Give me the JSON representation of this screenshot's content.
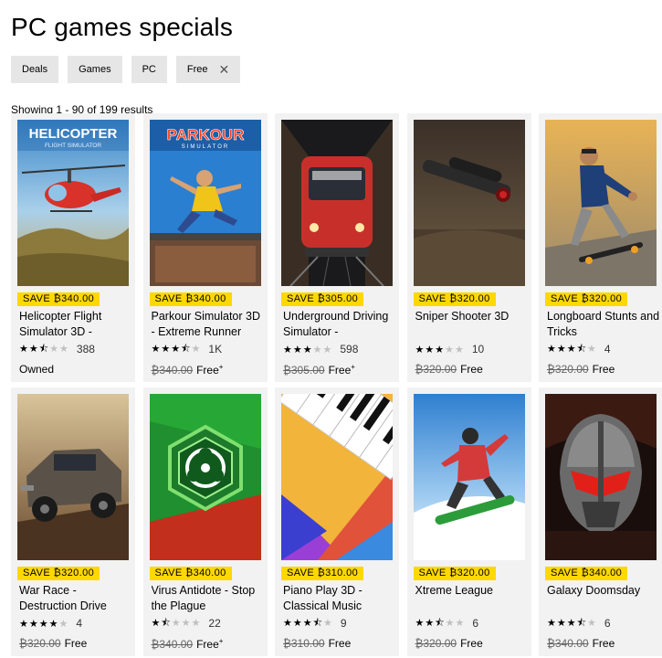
{
  "page": {
    "title": "PC games specials"
  },
  "filters": [
    {
      "label": "Deals",
      "removable": false
    },
    {
      "label": "Games",
      "removable": false
    },
    {
      "label": "PC",
      "removable": false
    },
    {
      "label": "Free",
      "removable": true,
      "remove_icon": "close-icon"
    }
  ],
  "results": {
    "text": "Showing 1 - 90 of 199 results"
  },
  "colors": {
    "badge": "#ffd800",
    "chip_bg": "#e6e6e6",
    "tile_bg": "#f2f2f2"
  },
  "products": [
    {
      "title": "Helicopter Flight Simulator 3D -",
      "badge": "SAVE ₿340.00",
      "stars": 2.5,
      "rating_count": "388",
      "price_original": "",
      "price_now": "Owned",
      "plus": "",
      "art": "helicopter"
    },
    {
      "title": "Parkour Simulator 3D - Extreme Runner",
      "badge": "SAVE ₿340.00",
      "stars": 3.5,
      "rating_count": "1K",
      "price_original": "₿340.00",
      "price_now": "Free",
      "plus": "+",
      "art": "parkour"
    },
    {
      "title": "Underground Driving Simulator -",
      "badge": "SAVE ₿305.00",
      "stars": 3,
      "rating_count": "598",
      "price_original": "₿305.00",
      "price_now": "Free",
      "plus": "+",
      "art": "train"
    },
    {
      "title": "Sniper Shooter 3D",
      "badge": "SAVE ₿320.00",
      "stars": 3,
      "rating_count": "10",
      "price_original": "₿320.00",
      "price_now": "Free",
      "plus": "",
      "art": "sniper"
    },
    {
      "title": "Longboard Stunts and Tricks",
      "badge": "SAVE ₿320.00",
      "stars": 3.5,
      "rating_count": "4",
      "price_original": "₿320.00",
      "price_now": "Free",
      "plus": "",
      "art": "longboard"
    },
    {
      "title": "War Race - Destruction Drive",
      "badge": "SAVE ₿320.00",
      "stars": 4,
      "rating_count": "4",
      "price_original": "₿320.00",
      "price_now": "Free",
      "plus": "",
      "art": "warrace"
    },
    {
      "title": "Virus Antidote - Stop the Plague",
      "badge": "SAVE ₿340.00",
      "stars": 1.5,
      "rating_count": "22",
      "price_original": "₿340.00",
      "price_now": "Free",
      "plus": "+",
      "art": "virus"
    },
    {
      "title": "Piano Play 3D - Classical Music",
      "badge": "SAVE ₿310.00",
      "stars": 3.5,
      "rating_count": "9",
      "price_original": "₿310.00",
      "price_now": "Free",
      "plus": "",
      "art": "piano"
    },
    {
      "title": "Xtreme League",
      "badge": "SAVE ₿320.00",
      "stars": 2.5,
      "rating_count": "6",
      "price_original": "₿320.00",
      "price_now": "Free",
      "plus": "",
      "art": "snowboard"
    },
    {
      "title": "Galaxy Doomsday",
      "badge": "SAVE ₿340.00",
      "stars": 3.5,
      "rating_count": "6",
      "price_original": "₿340.00",
      "price_now": "Free",
      "plus": "",
      "art": "galaxy"
    }
  ]
}
